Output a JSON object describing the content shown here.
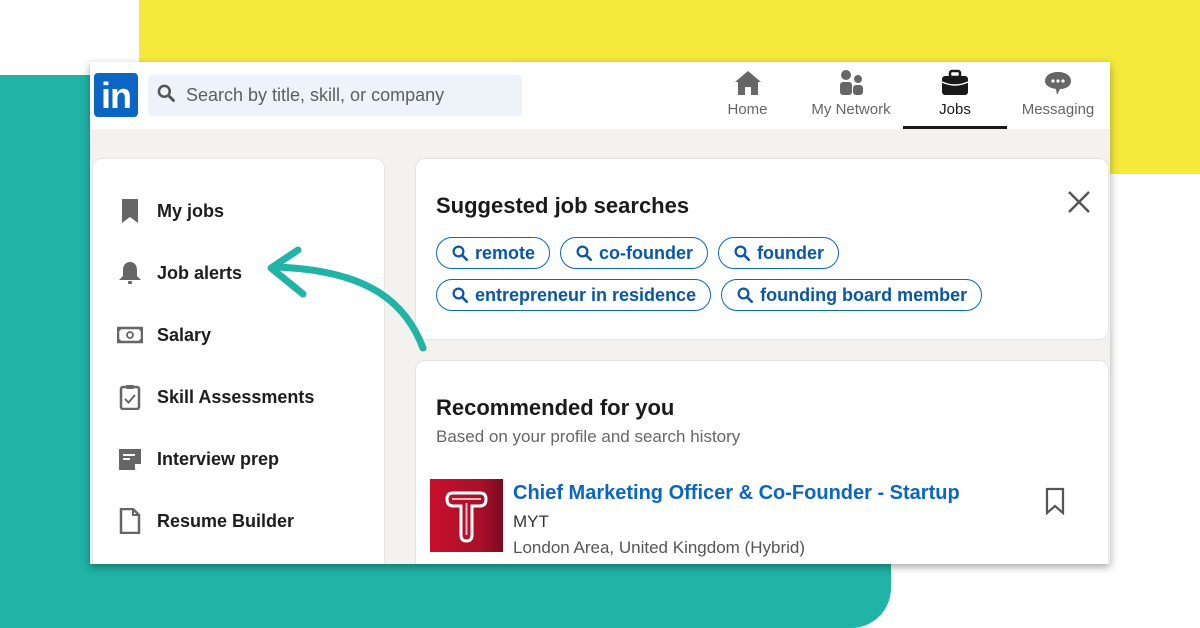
{
  "colors": {
    "background_yellow": "#f5e93c",
    "background_teal": "#20b3a6",
    "linkedin_blue": "#0a66c2",
    "arrow": "#20b3a6"
  },
  "header": {
    "logo_text": "in",
    "search": {
      "placeholder": "Search by title, skill, or company",
      "value": "",
      "icon": "search-icon"
    },
    "nav": [
      {
        "label": "Home",
        "icon": "home-icon",
        "active": false
      },
      {
        "label": "My Network",
        "icon": "network-icon",
        "active": false
      },
      {
        "label": "Jobs",
        "icon": "briefcase-icon",
        "active": true
      },
      {
        "label": "Messaging",
        "icon": "chat-bubble-icon",
        "active": false
      }
    ]
  },
  "sidebar": {
    "items": [
      {
        "label": "My jobs",
        "icon": "bookmark-icon"
      },
      {
        "label": "Job alerts",
        "icon": "bell-icon"
      },
      {
        "label": "Salary",
        "icon": "banknote-icon"
      },
      {
        "label": "Skill Assessments",
        "icon": "clipboard-check-icon"
      },
      {
        "label": "Interview prep",
        "icon": "note-icon"
      },
      {
        "label": "Resume Builder",
        "icon": "document-icon"
      }
    ]
  },
  "suggested": {
    "title": "Suggested job searches",
    "close_icon": "close-icon",
    "pills": [
      [
        "remote",
        "co-founder",
        "founder"
      ],
      [
        "entrepreneur in residence",
        "founding board member"
      ]
    ]
  },
  "recommended": {
    "title": "Recommended for you",
    "subtitle": "Based on your profile and search history",
    "jobs": [
      {
        "title": "Chief Marketing Officer & Co-Founder - Startup",
        "company": "MYT",
        "location": "London Area, United Kingdom (Hybrid)",
        "logo_letter": "T",
        "save_icon": "bookmark-outline-icon"
      }
    ]
  }
}
